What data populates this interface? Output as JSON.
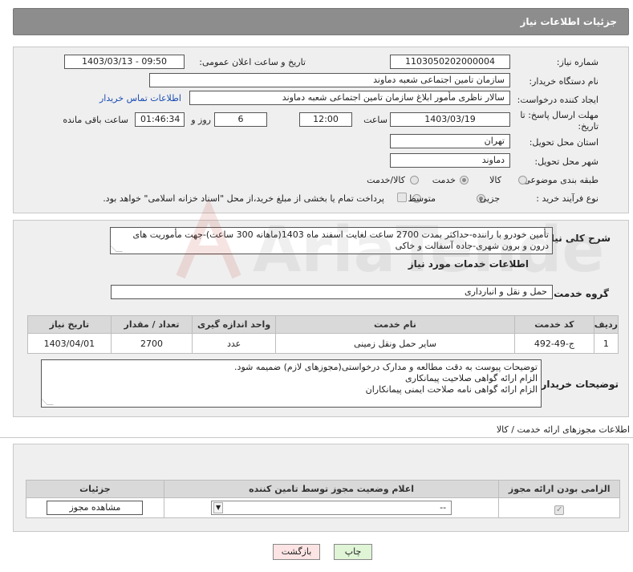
{
  "header": {
    "title": "جزئیات اطلاعات نیاز"
  },
  "need_info": {
    "need_number_label": "شماره نیاز:",
    "need_number": "1103050202000004",
    "announce_label": "تاریخ و ساعت اعلان عمومی:",
    "announce_value": "1403/03/13 - 09:50",
    "buyer_org_label": "نام دستگاه خریدار:",
    "buyer_org": "سازمان تامین اجتماعی شعبه دماوند",
    "requester_label": "ایجاد کننده درخواست:",
    "requester": "سالار ناظری مأمور ابلاغ سازمان تامین اجتماعی شعبه دماوند",
    "contact_link": "اطلاعات تماس خریدار",
    "deadline_label_1": "مهلت ارسال پاسخ: تا",
    "deadline_label_2": "تاریخ:",
    "deadline_date": "1403/03/19",
    "time_label": "ساعت",
    "deadline_time": "12:00",
    "days_value": "6",
    "days_label": "روز و",
    "remaining_time": "01:46:34",
    "remaining_label": "ساعت باقی مانده",
    "province_label": "استان محل تحویل:",
    "province": "تهران",
    "city_label": "شهر محل تحویل:",
    "city": "دماوند",
    "category_label": "طبقه بندی موضوعی:",
    "category_options": [
      "کالا",
      "خدمت",
      "کالا/خدمت"
    ],
    "category_selected": "خدمت",
    "process_label": "نوع فرآیند خرید :",
    "process_options": [
      "جزیی",
      "متوسط"
    ],
    "process_selected": "جزیی",
    "treasury_note": "پرداخت تمام یا بخشی از مبلغ خرید،از محل \"اسناد خزانه اسلامی\" خواهد بود."
  },
  "summary": {
    "label": "شرح کلی نیاز:",
    "text": "تأمین خودرو با راننده-حداکثر بمدت 2700 ساعت لغایت اسفند ماه 1403(ماهانه 300 ساعت)-جهت مأموریت های درون و برون شهری-جاده آسفالت و خاکی"
  },
  "services": {
    "section_title": "اطلاعات خدمات مورد نیاز",
    "group_label": "گروه خدمت:",
    "group_value": "حمل و نقل و انبارداری",
    "columns": [
      "ردیف",
      "کد خدمت",
      "نام خدمت",
      "واحد اندازه گیری",
      "تعداد / مقدار",
      "تاریخ نیاز"
    ],
    "rows": [
      [
        "1",
        "ج-49-492",
        "سایر حمل ونقل زمینی",
        "عدد",
        "2700",
        "1403/04/01"
      ]
    ]
  },
  "buyer_notes": {
    "label": "توضیحات خریدار:",
    "lines": [
      "توضیحات پیوست به دقت مطالعه و مدارک درخواستی(مجوزهای لازم) ضمیمه شود.",
      "الزام ارائه گواهی صلاحیت پیمانکاری",
      "الزام ارائه گواهی نامه صلاحت ایمنی پیمانکاران"
    ]
  },
  "permits": {
    "section_title": "اطلاعات مجوزهای ارائه خدمت / کالا",
    "columns": [
      "الزامی بودن ارائه مجوز",
      "اعلام وضعیت مجوز توسط تامین کننده",
      "جزئیات"
    ],
    "select_value": "--",
    "view_button": "مشاهده مجوز"
  },
  "footer": {
    "print_label": "چاپ",
    "back_label": "بازگشت"
  },
  "watermark_text": "AriaTender.neT",
  "colors": {
    "header_bg": "#8d8d8d",
    "panel_bg": "#efefef",
    "link": "#1a4db3",
    "print_btn": "#dff5d6",
    "back_btn": "#fde4e4"
  }
}
